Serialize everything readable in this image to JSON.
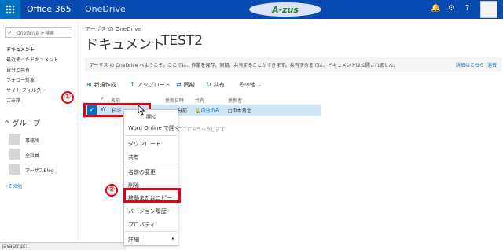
{
  "suitebar": {
    "brand": "Office 365",
    "app": "OneDrive",
    "logo_text": "アーザス",
    "icons": [
      "waffle-icon",
      "bell-icon",
      "gear-icon",
      "help-icon"
    ]
  },
  "leftnav": {
    "search_placeholder": "OneDrive を検索",
    "items": [
      "ドキュメント",
      "最近使ったドキュメント",
      "自分と共有",
      "フォロー対象",
      "サイト フォルダー",
      "ごみ箱"
    ],
    "groups_header": "グループ",
    "groups": [
      "事務所",
      "全社員",
      "アーザスBlog"
    ],
    "more": "その他"
  },
  "main": {
    "crumb_small": "アーザス の OneDrive",
    "title": "ドキュメント",
    "title_sep": "›",
    "subtitle": "TEST2",
    "banner_text": "アーザス の OneDrive へようこそ。ここでは、作業を保存、同期、共有することができます。共有するまでは、ドキュメントは公開されません。",
    "banner_link_details": "詳細はこちら",
    "banner_link_dismiss": "消去",
    "commands": [
      {
        "icon": "plus-icon",
        "label": "新規作成"
      },
      {
        "icon": "upload-icon",
        "label": "アップロード"
      },
      {
        "icon": "sync-icon",
        "label": "同期"
      },
      {
        "icon": "share-icon",
        "label": "共有"
      },
      {
        "icon": "more-icon",
        "label": "その他"
      }
    ],
    "columns": {
      "name": "名前",
      "modified": "更新日時",
      "sharing": "共有",
      "updated_by": "更新者"
    },
    "row": {
      "name": "ドキュ",
      "modified": "分前",
      "sharing": "自分のみ",
      "updated_by": "掛本貴之"
    },
    "drop_tip": "ここにドラッグします",
    "status_url": "javascript:;"
  },
  "annotations": {
    "step1": "①",
    "step2": "②"
  },
  "context_menu": {
    "items": [
      "開く",
      "Word Online で開く",
      "ダウンロード",
      "共有",
      "名前の変更",
      "削除",
      "移動またはコピー",
      "バージョン履歴",
      "プロパティ",
      "詳細"
    ]
  },
  "colors": {
    "suitebar": "#094ab2",
    "accent": "#0072c6",
    "highlight_red": "#e60012",
    "selected_row": "#cde6f7"
  }
}
